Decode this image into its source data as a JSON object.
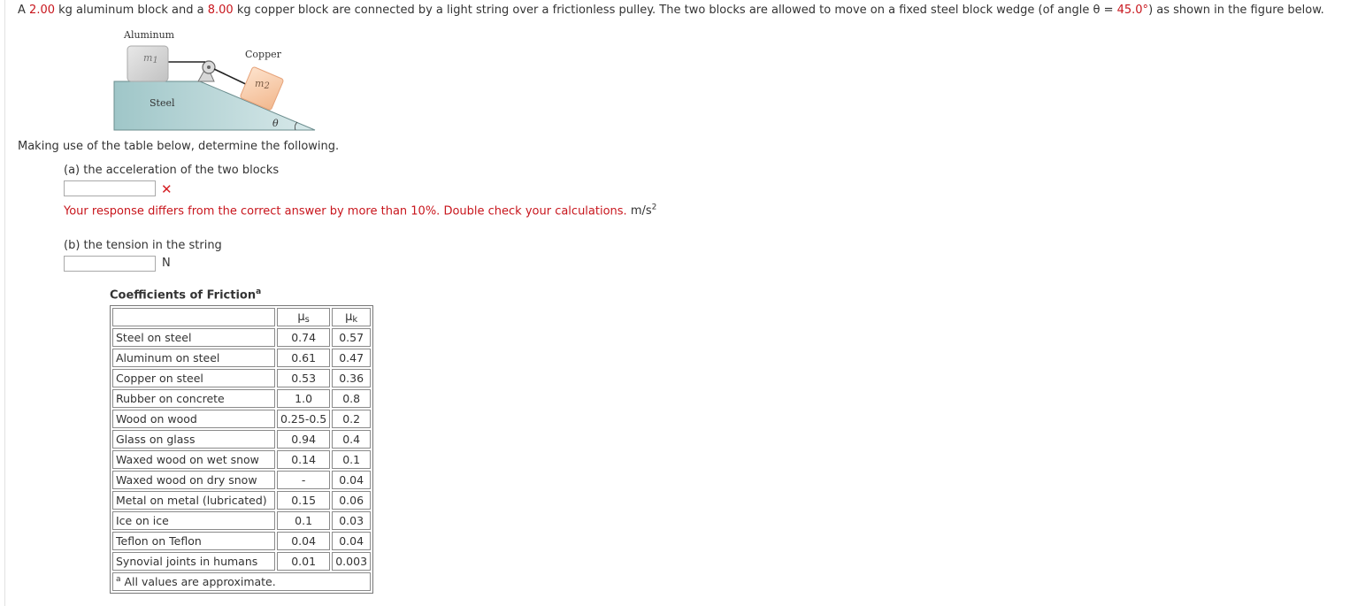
{
  "question": {
    "part1": "A",
    "mass1": "2.00",
    "part2": "kg aluminum block and a",
    "mass2": "8.00",
    "part3": "kg copper block are connected by a light string over a frictionless pulley. The two blocks are allowed to move on a fixed steel block wedge (of angle θ =",
    "angle": "45.0°",
    "part4": ") as shown in the figure below."
  },
  "figure": {
    "aluminum_label": "Aluminum",
    "copper_label": "Copper",
    "steel_label": "Steel",
    "m1_label": "m",
    "m1_sub": "1",
    "m2_label": "m",
    "m2_sub": "2",
    "theta_label": "θ"
  },
  "instruction": "Making use of the table below, determine the following.",
  "part_a": {
    "label": "(a) the acceleration of the two blocks",
    "value": "",
    "feedback": "Your response differs from the correct answer by more than 10%. Double check your calculations.",
    "unit": "m/s",
    "unit_sup": "2"
  },
  "part_b": {
    "label": "(b) the tension in the string",
    "value": "",
    "unit": "N"
  },
  "table": {
    "title": "Coefficients of Friction",
    "title_sup": "a",
    "header_mu": "μ",
    "header_s": "s",
    "header_k": "k",
    "rows": [
      [
        "Steel on steel",
        "0.74",
        "0.57"
      ],
      [
        "Aluminum on steel",
        "0.61",
        "0.47"
      ],
      [
        "Copper on steel",
        "0.53",
        "0.36"
      ],
      [
        "Rubber on concrete",
        "1.0",
        "0.8"
      ],
      [
        "Wood on wood",
        "0.25-0.5",
        "0.2"
      ],
      [
        "Glass on glass",
        "0.94",
        "0.4"
      ],
      [
        "Waxed wood on wet snow",
        "0.14",
        "0.1"
      ],
      [
        "Waxed wood on dry snow",
        "-",
        "0.04"
      ],
      [
        "Metal on metal (lubricated)",
        "0.15",
        "0.06"
      ],
      [
        "Ice on ice",
        "0.1",
        "0.03"
      ],
      [
        "Teflon on Teflon",
        "0.04",
        "0.04"
      ],
      [
        "Synovial joints in humans",
        "0.01",
        "0.003"
      ]
    ],
    "footnote_mark": "a",
    "footnote": "All values are approximate."
  },
  "colors": {
    "highlight": "#c8161d",
    "error_icon": "#d51f24"
  }
}
